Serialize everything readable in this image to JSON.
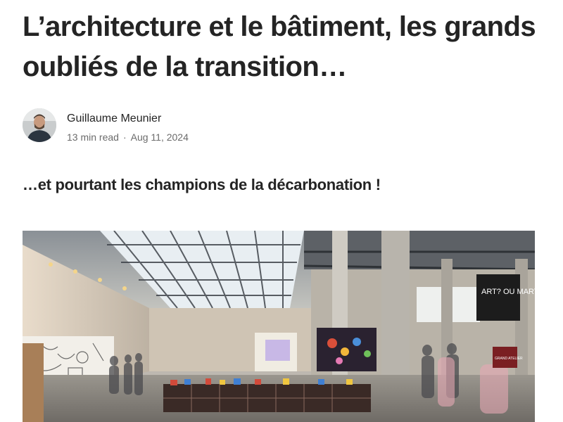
{
  "article": {
    "title": "L’architecture et le bâtiment, les grands oubliés de la transition…",
    "subtitle": "…et pourtant les champions de la décarbonation !"
  },
  "author": {
    "name": "Guillaume Meunier",
    "read_time": "13 min read",
    "separator": "·",
    "date": "Aug 11, 2024"
  },
  "hero_image": {
    "banner_text": "ART? OU MART?",
    "sign_text": "GRAND ATELIER"
  },
  "colors": {
    "text": "#242424",
    "meta": "#6b6b6b",
    "background": "#ffffff"
  }
}
